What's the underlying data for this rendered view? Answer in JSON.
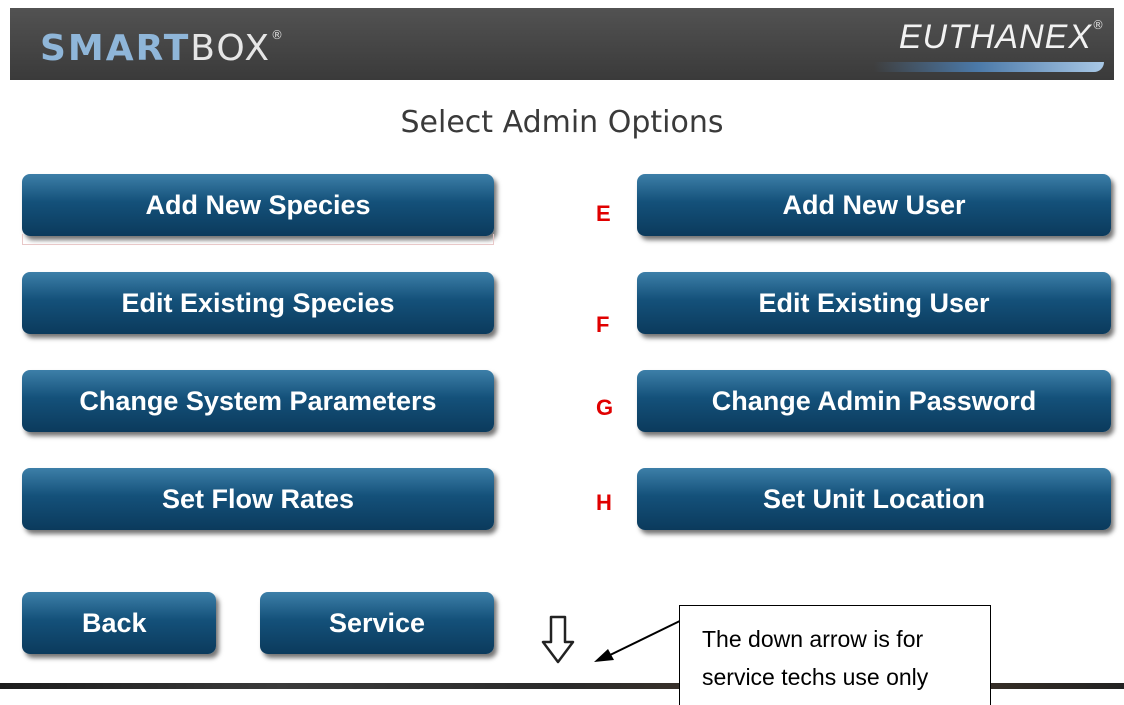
{
  "header": {
    "brand_smart": "SMART",
    "brand_box": "BOX",
    "brand_mark": "®",
    "logo": "EUTHANEX",
    "logo_mark": "®"
  },
  "page_title": "Select Admin Options",
  "buttons": {
    "add_species": "Add New Species",
    "edit_species": "Edit Existing Species",
    "change_params": "Change System Parameters",
    "set_flow": "Set Flow Rates",
    "add_user": "Add New User",
    "edit_user": "Edit Existing User",
    "change_password": "Change Admin Password",
    "set_location": "Set Unit Location",
    "back": "Back",
    "service": "Service"
  },
  "markers": {
    "e": "E",
    "f": "F",
    "g": "G",
    "h": "H"
  },
  "callout": {
    "line1": "The down arrow is for",
    "line2": "service techs use only"
  },
  "icons": {
    "down_arrow": "down-arrow-icon",
    "pointer": "pointer-arrow"
  },
  "colors": {
    "button_top": "#3d7fa8",
    "button_bottom": "#0b3a5c",
    "marker": "#e00000",
    "header": "#464646"
  }
}
